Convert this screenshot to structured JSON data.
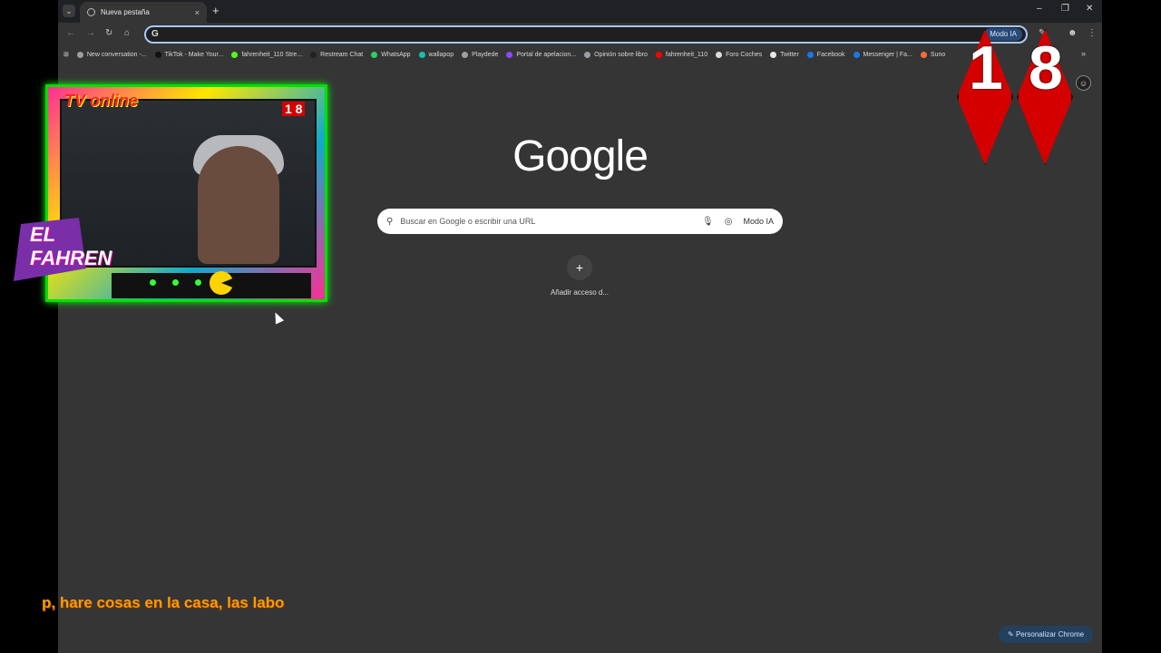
{
  "browser": {
    "tab_title": "Nueva pestaña",
    "tab_close": "×",
    "new_tab": "+",
    "tab_menu": "⌄",
    "window_controls": [
      "–",
      "❐",
      "✕"
    ]
  },
  "toolbar": {
    "back": "←",
    "forward": "→",
    "reload": "↻",
    "home": "⌂",
    "omnibox_icon": "G",
    "omnibox_modo_ia": "Modo IA",
    "menu": "⋮"
  },
  "bookmarks": {
    "apps_icon": "⊞",
    "items": [
      {
        "label": "New conversation -...",
        "color": "#9aa0a6"
      },
      {
        "label": "TikTok - Make Your...",
        "color": "#111111"
      },
      {
        "label": "fahrenheit_110 Stre...",
        "color": "#53fc18"
      },
      {
        "label": "Restream Chat",
        "color": "#202124"
      },
      {
        "label": "WhatsApp",
        "color": "#25d366"
      },
      {
        "label": "wallapop",
        "color": "#13c1ac"
      },
      {
        "label": "Playdede",
        "color": "#9aa0a6"
      },
      {
        "label": "Portal de apelacion...",
        "color": "#9147ff"
      },
      {
        "label": "Opinión sobre libro",
        "color": "#9aa0a6"
      },
      {
        "label": "fahrenheit_110",
        "color": "#ff0000"
      },
      {
        "label": "Foro Coches",
        "color": "#dddddd"
      },
      {
        "label": "Twitter",
        "color": "#e8e8e8"
      },
      {
        "label": "Facebook",
        "color": "#1877f2"
      },
      {
        "label": "Messenger | Fa...",
        "color": "#1877f2"
      },
      {
        "label": "Suno",
        "color": "#ff6b3d"
      }
    ],
    "more": "»"
  },
  "main": {
    "logo": "Google",
    "search_placeholder": "Buscar en Google o escribir una URL",
    "search_modo_ia": "Modo IA",
    "shortcut_plus": "+",
    "shortcut_label": "Añadir acceso d...",
    "personalize": "Personalizar Chrome"
  },
  "overlay": {
    "rating_digits": [
      "1",
      "8"
    ],
    "webcam_title": "TV online",
    "webcam_badge": "1 8",
    "brand": "EL FAHREN",
    "ticker": "p, hare cosas en la casa, las labo"
  }
}
